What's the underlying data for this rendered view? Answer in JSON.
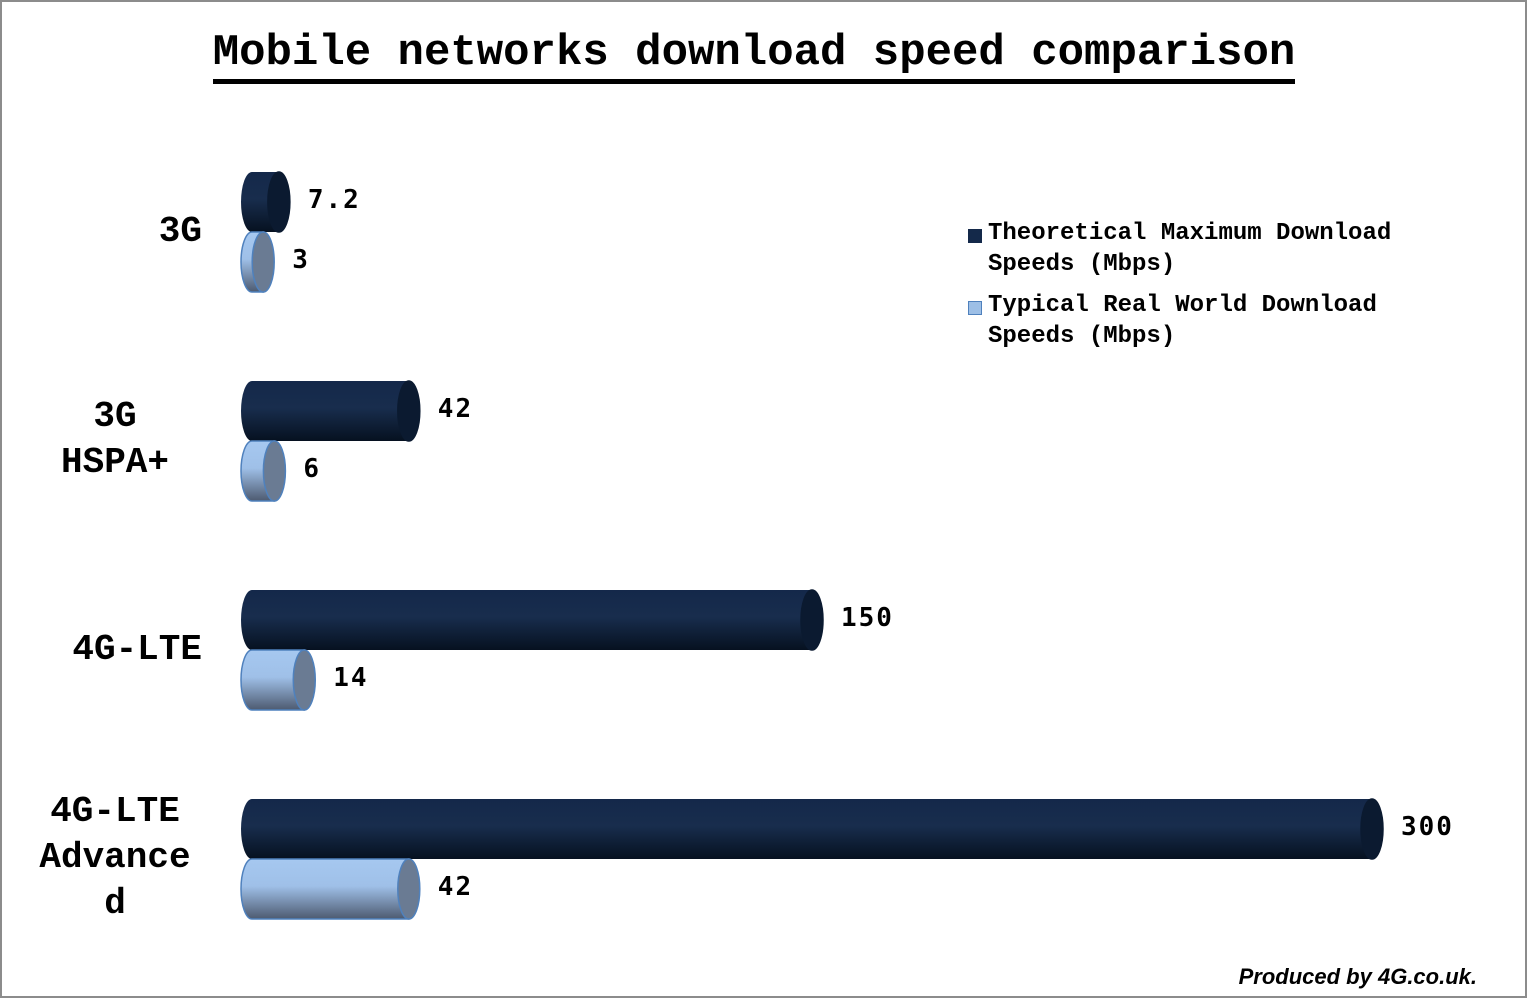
{
  "chart_data": {
    "type": "bar",
    "orientation": "horizontal",
    "style": "3d-cylinder",
    "title": "Mobile networks download speed comparison",
    "xlabel": "",
    "ylabel": "",
    "xlim": [
      0,
      300
    ],
    "grid": false,
    "legend_position": "right",
    "categories": [
      "3G",
      "3G\nHSPA+",
      "4G-LTE",
      "4G-LTE\nAdvance\nd"
    ],
    "series": [
      {
        "name": "Theoretical Maximum Download\nSpeeds (Mbps)",
        "color": "#14294a",
        "values": [
          7.2,
          42,
          150,
          300
        ],
        "labels": [
          "7.2",
          "42",
          "150",
          "300"
        ]
      },
      {
        "name": "Typical Real World Download\nSpeeds (Mbps)",
        "color": "#9dbfe6",
        "values": [
          3,
          6,
          14,
          42
        ],
        "labels": [
          "3",
          "6",
          "14",
          "42"
        ]
      }
    ],
    "annotations": [
      "Produced by 4G.co.uk."
    ]
  },
  "footer": {
    "credit": "Produced by 4G.co.uk."
  }
}
